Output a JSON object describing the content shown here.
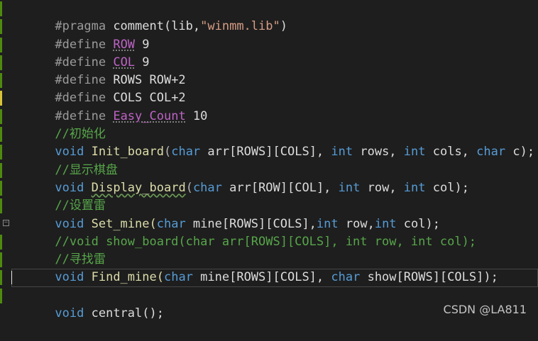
{
  "lines": [
    {
      "t1": "#pragma",
      "t2": " comment(lib,",
      "t3": "\"winmm.lib\"",
      "t4": ")"
    },
    {
      "t1": "#define",
      "t2": " ",
      "t3": "ROW",
      "t4": " 9"
    },
    {
      "t1": "#define",
      "t2": " ",
      "t3": "COL",
      "t4": " 9"
    },
    {
      "t1": "#define",
      "t2": " ROWS ROW+2"
    },
    {
      "t1": "#define",
      "t2": " COLS COL+2"
    },
    {
      "t1": "#define",
      "t2": " ",
      "t3": "Easy_Count",
      "t4": " 10"
    },
    {
      "t1": "//初始化"
    },
    {
      "t1": "void",
      "t2": " Init_board",
      "t3": "(",
      "t4": "char",
      "t5": " arr[ROWS][COLS], ",
      "t6": "int",
      "t7": " rows, ",
      "t8": "int",
      "t9": " cols, ",
      "t10": "char",
      "t11": " c);"
    },
    {
      "t1": "//显示棋盘"
    },
    {
      "t1": "void",
      "t2": " ",
      "t3": "Display_board",
      "t4": "(",
      "t5": "char",
      "t6": " arr[ROW][COL], ",
      "t7": "int",
      "t8": " row, ",
      "t9": "int",
      "t10": " col);"
    },
    {
      "t1": "//设置雷"
    },
    {
      "t1": "void",
      "t2": " Set_mine(",
      "t3": "char",
      "t4": " mine[ROWS][COLS],",
      "t5": "int",
      "t6": " row,",
      "t7": "int",
      "t8": " col);"
    },
    {
      "t1": "//void show_board(char arr[ROWS][COLS], int row, int col);"
    },
    {
      "t1": "//寻找雷"
    },
    {
      "t1": "void",
      "t2": " Find_mine(",
      "t3": "char",
      "t4": " mine[ROWS][COLS], ",
      "t5": "char",
      "t6": " show[ROWS][COLS]);"
    },
    {
      "t1": ""
    },
    {
      "t1": "void",
      "t2": " central();"
    }
  ],
  "watermark": "CSDN @LA811",
  "colors": {
    "background": "#1e1e1e",
    "keyword": "#569cd6",
    "comment": "#57a64a",
    "string": "#d69d85",
    "function": "#dcdcaa",
    "preprocessor": "#9b9b9b"
  }
}
